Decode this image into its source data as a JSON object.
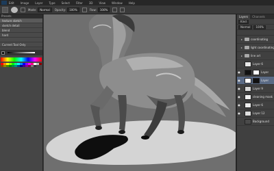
{
  "menu": {
    "items": [
      "Edit",
      "Image",
      "Layer",
      "Type",
      "Select",
      "Filter",
      "3D",
      "View",
      "Window",
      "Help"
    ]
  },
  "options": {
    "mode_label": "Mode:",
    "mode_value": "Normal",
    "opacity_label": "Opacity:",
    "opacity_value": "100%",
    "flow_label": "Flow:",
    "flow_value": "100%"
  },
  "left_panel": {
    "header": "Presets",
    "presets": [
      "texture sketch",
      "sketch detail",
      "blend",
      "hard",
      "",
      "Current Tool Only"
    ]
  },
  "layers": {
    "tabs": [
      "Layers",
      "Channels"
    ],
    "filter_value": "Kind",
    "blend_mode": "Normal",
    "opacity_value": "100%",
    "items": [
      {
        "name": "coordinating",
        "type": "folder",
        "visible": false
      },
      {
        "name": "light coordinating",
        "type": "folder",
        "visible": false
      },
      {
        "name": "line art",
        "type": "folder",
        "visible": false
      },
      {
        "name": "Layer 6",
        "type": "layer",
        "visible": false
      },
      {
        "name": "Layer",
        "type": "mask",
        "visible": true
      },
      {
        "name": "Layer",
        "type": "mask",
        "visible": true,
        "selected": true
      },
      {
        "name": "Layer 9",
        "type": "layer",
        "visible": true
      },
      {
        "name": "cleaning mask",
        "type": "layer",
        "visible": true
      },
      {
        "name": "Layer 6",
        "type": "layer",
        "visible": true
      },
      {
        "name": "Layer 12",
        "type": "layer",
        "visible": true
      },
      {
        "name": "Background",
        "type": "background",
        "visible": false
      }
    ]
  },
  "colors": {
    "selection": "#5a6a85",
    "canvas_bg": "#6f6f6f",
    "ground": "#d4d4d4"
  }
}
